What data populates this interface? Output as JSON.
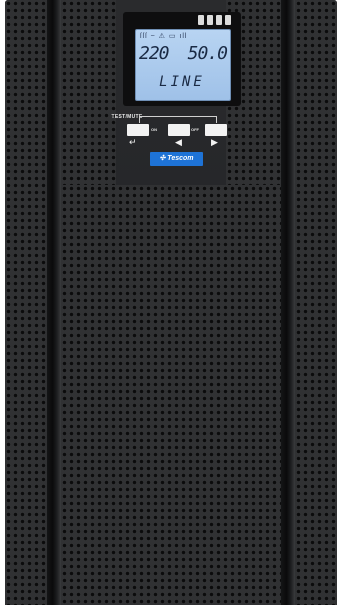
{
  "device": {
    "brand": "Tescom",
    "colors": {
      "body": "#2b2c2e",
      "lcd": "#aecbee",
      "badge": "#1e73d6"
    }
  },
  "lcd": {
    "top_icons": "ſſſ ~ ⚠ ▭ ıll",
    "voltage": "220",
    "frequency": "50.0",
    "mode": "LINE"
  },
  "controls": {
    "test_mute_label": "TEST/MUTE",
    "on_label": "ON",
    "off_label": "OFF",
    "led_count": 4
  }
}
